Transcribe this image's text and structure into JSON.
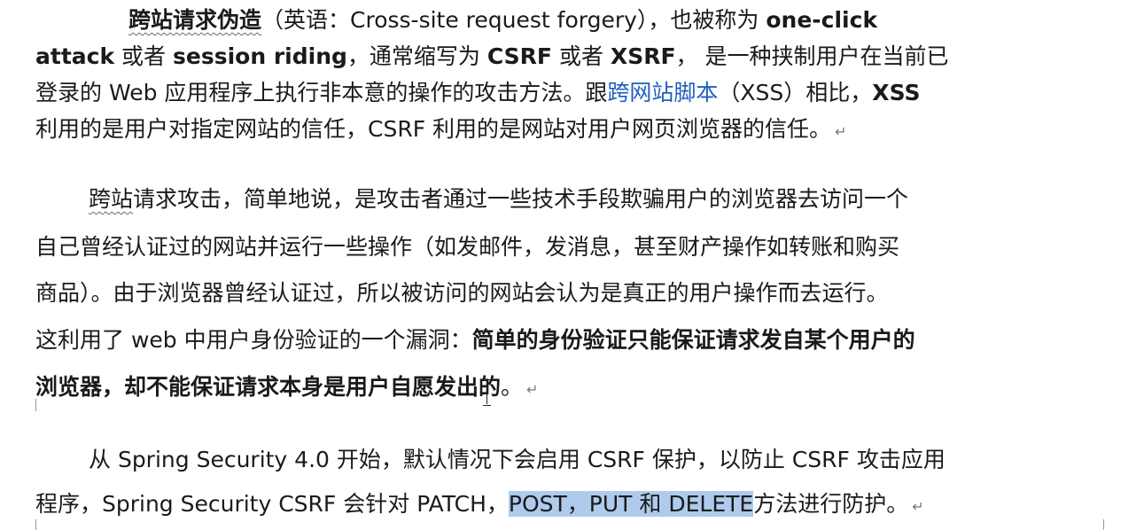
{
  "paragraph1": {
    "l1": {
      "a": "跨站请求伪造",
      "b": "（英语：Cross-site request forgery），也被称为 ",
      "c": "one-click"
    },
    "l2": {
      "a": "attack",
      "b": " 或者 ",
      "c": "session riding",
      "d": "，通常缩写为 ",
      "e": "CSRF",
      "f": " 或者 ",
      "g": "XSRF",
      "h": "， 是一种挟制用户在当前已"
    },
    "l3": {
      "a": "登录的 Web 应用程序上执行非本意的操作的攻击方法。跟",
      "b": "跨网站脚本",
      "c": "（XSS）相比，",
      "d": "XSS"
    },
    "l4": {
      "a": "利用的是用户对指定网站的信任，CSRF 利用的是网站对用户网页浏览器的信任。"
    }
  },
  "paragraph2": {
    "l1": {
      "a": "跨站",
      "b": "请求攻击，简单地说，是攻击者通过一些技术手段欺骗用户的浏览器去访问一个"
    },
    "l2": {
      "a": "自己曾经认证过的网站并运行一些操作（如发邮件，发消息，甚至财产操作如转账和购买"
    },
    "l3": {
      "a": "商品）。由于浏览器曾经认证过，所以被访问的网站会认为是真正的用户操作而去运行。"
    },
    "l4": {
      "a": "这利用了 web 中用户身份验证的一个漏洞：",
      "b": "简单的身份验证只能保证请求发自某个用户的"
    },
    "l5": {
      "a": "浏览器，却不能保证请求本身是用户自愿发出的",
      "b": "。"
    }
  },
  "paragraph3": {
    "l1": {
      "a": "从 Spring Security 4.0 开始，默认情况下会启用 CSRF 保护，以防止 CSRF 攻击应用"
    },
    "l2": {
      "a": "程序，Spring Security CSRF 会针对 PATCH，",
      "b": "POST，PUT 和 DELETE",
      "c": "方法进行防护。"
    }
  },
  "paragraph_mark": "↵"
}
